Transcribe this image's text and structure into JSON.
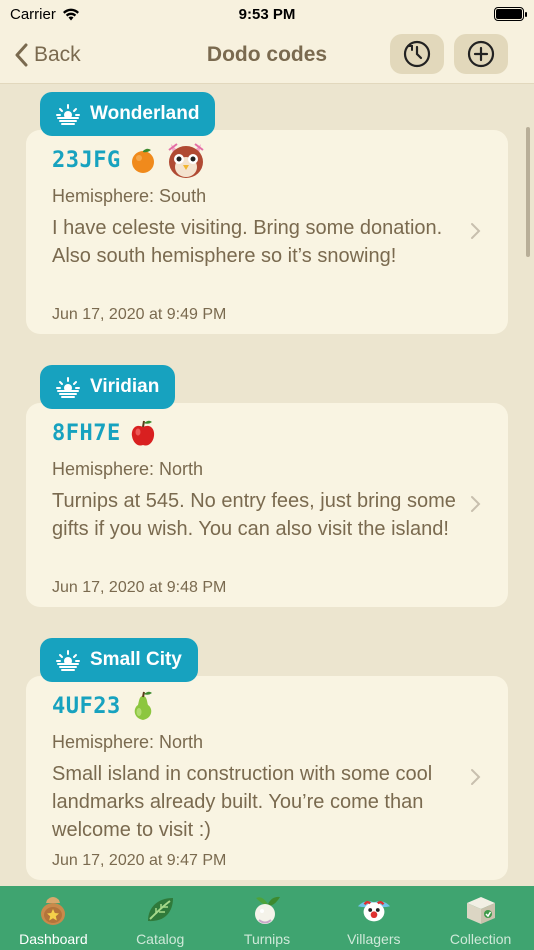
{
  "status_bar": {
    "carrier": "Carrier",
    "time": "9:53 PM"
  },
  "nav": {
    "back_label": "Back",
    "title": "Dodo codes"
  },
  "entries": [
    {
      "island": "Wonderland",
      "code": "23JFG",
      "fruit_icon": "orange-icon",
      "villager_icon": "celeste-owl-icon",
      "hemisphere": "Hemisphere: South",
      "description": "I have celeste visiting. Bring some donation. Also south hemisphere so it’s snowing!",
      "date": "Jun 17, 2020 at 9:49 PM"
    },
    {
      "island": "Viridian",
      "code": "8FH7E",
      "fruit_icon": "apple-icon",
      "hemisphere": "Hemisphere: North",
      "description": "Turnips at 545. No entry fees, just bring some gifts if you wish. You can also visit the island!",
      "date": "Jun 17, 2020 at 9:48 PM"
    },
    {
      "island": "Small City",
      "code": "4UF23",
      "fruit_icon": "pear-icon",
      "hemisphere": "Hemisphere: North",
      "description": "Small island in construction with some cool landmarks already built. You’re come than welcome to visit :)",
      "date": "Jun 17, 2020 at 9:47 PM"
    }
  ],
  "tabs": [
    {
      "label": "Dashboard",
      "icon": "bag-icon",
      "active": true
    },
    {
      "label": "Catalog",
      "icon": "leaf-icon",
      "active": false
    },
    {
      "label": "Turnips",
      "icon": "turnip-icon",
      "active": false
    },
    {
      "label": "Villagers",
      "icon": "villager-icon",
      "active": false
    },
    {
      "label": "Collection",
      "icon": "box-icon",
      "active": false
    }
  ],
  "colors": {
    "accent": "#17a2bf",
    "tabbar": "#3fa470",
    "background": "#ece5cf",
    "card": "#f9f4e2",
    "text": "#7a6a4f"
  }
}
